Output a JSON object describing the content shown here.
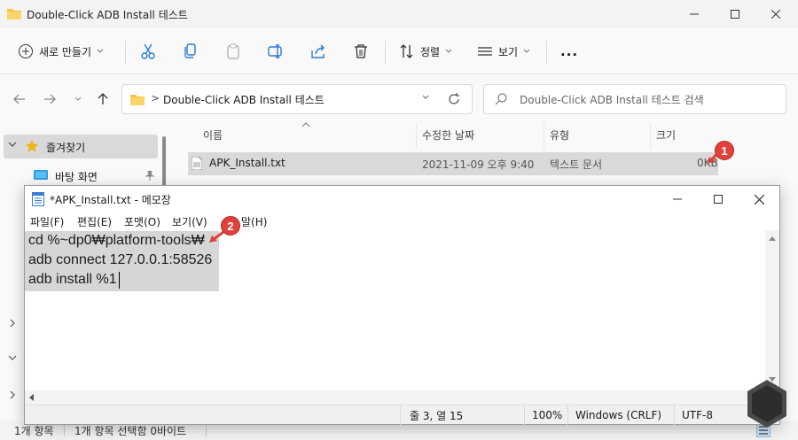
{
  "explorer": {
    "window_title": "Double-Click ADB Install 테스트",
    "toolbar": {
      "new_label": "새로 만들기",
      "sort_label": "정렬",
      "view_label": "보기",
      "more_label": "..."
    },
    "address": {
      "path_sep": ">",
      "path": "Double-Click ADB Install 테스트"
    },
    "search": {
      "placeholder": "Double-Click ADB Install 테스트 검색"
    },
    "sidebar": {
      "quick_access": "즐겨찾기",
      "desktop": "바탕 화면"
    },
    "columns": {
      "name": "이름",
      "modified": "수정한 날짜",
      "type": "유형",
      "size": "크기"
    },
    "files": [
      {
        "name": "APK_Install.txt",
        "modified": "2021-11-09 오후 9:40",
        "type": "텍스트 문서",
        "size": "0KB"
      }
    ],
    "status": {
      "count": "1개 항목",
      "selection": "1개 항목 선택함 0바이트"
    }
  },
  "notepad": {
    "title": "*APK_Install.txt - 메모장",
    "menu": {
      "file": "파일(F)",
      "edit": "편집(E)",
      "format": "포맷(O)",
      "view": "보기(V)",
      "help": "말(H)"
    },
    "lines": [
      "cd %~dp0₩platform-tools₩",
      "adb connect 127.0.0.1:58526",
      "adb install %1"
    ],
    "status": {
      "position": "줄 3, 열 15",
      "zoom": "100%",
      "eol": "Windows (CRLF)",
      "encoding": "UTF-8"
    }
  },
  "badges": {
    "one": "1",
    "two": "2"
  },
  "colors": {
    "badge": "#e0413a",
    "selection": "#d6d6d6",
    "folder": "#f5c342"
  }
}
